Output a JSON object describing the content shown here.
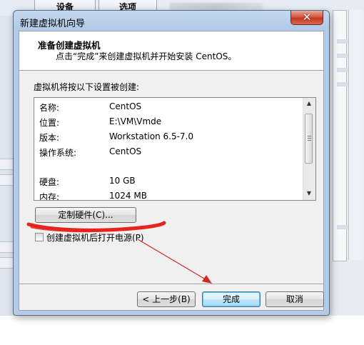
{
  "background": {
    "tabs": [
      "设备",
      "选项"
    ]
  },
  "dialog": {
    "title": "新建虚拟机向导",
    "close_symbol": "✕",
    "header": {
      "title": "准备创建虚拟机",
      "subtitle": "点击“完成”来创建虚拟机并开始安装 CentOS。"
    },
    "intro": "虚拟机将按以下设置被创建:",
    "settings": [
      {
        "key": "名称:",
        "value": "CentOS"
      },
      {
        "key": "位置:",
        "value": "E:\\VM\\Vmde"
      },
      {
        "key": "版本:",
        "value": "Workstation 6.5-7.0"
      },
      {
        "key": "操作系统:",
        "value": "CentOS"
      },
      {
        "key": "",
        "value": ""
      },
      {
        "key": "硬盘:",
        "value": "10 GB"
      },
      {
        "key": "内存:",
        "value": "1024 MB"
      }
    ],
    "customize_button": "定制硬件(C)...",
    "power_on_checkbox": {
      "label": "创建虚拟机后打开电源(P)",
      "checked": false
    },
    "buttons": {
      "back": "< 上一步(B)",
      "finish": "完成",
      "cancel": "取消"
    }
  },
  "annotation": {
    "underline_color": "#e8231e",
    "arrow_color": "#d12a25"
  }
}
